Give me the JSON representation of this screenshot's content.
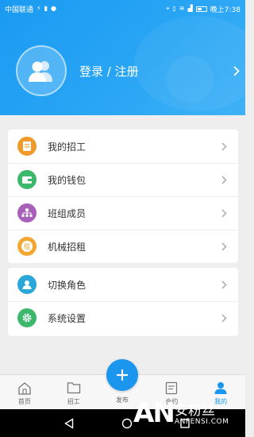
{
  "status_bar": {
    "carrier": "中国联通",
    "time": "晚上7:38"
  },
  "profile": {
    "login_label": "登录 / 注册"
  },
  "menu_group_1": [
    {
      "label": "我的招工",
      "icon": "document-icon",
      "color": "#f19a2a"
    },
    {
      "label": "我的钱包",
      "icon": "wallet-icon",
      "color": "#3cb86b"
    },
    {
      "label": "班组成员",
      "icon": "org-chart-icon",
      "color": "#a860b8"
    },
    {
      "label": "机械招租",
      "icon": "rent-icon",
      "color": "#f3a630",
      "badge": "租"
    }
  ],
  "menu_group_2": [
    {
      "label": "切换角色",
      "icon": "switch-role-icon",
      "color": "#29a7d8"
    },
    {
      "label": "系统设置",
      "icon": "gear-icon",
      "color": "#3cb86b"
    }
  ],
  "bottom_nav": {
    "home": "首页",
    "jobs": "招工",
    "publish": "发布",
    "contract": "合约",
    "mine": "我的",
    "accent": "#1b96ee"
  },
  "watermark": {
    "logo": "AN",
    "cn": "安粉丝",
    "en": "ANFENSI.COM"
  }
}
